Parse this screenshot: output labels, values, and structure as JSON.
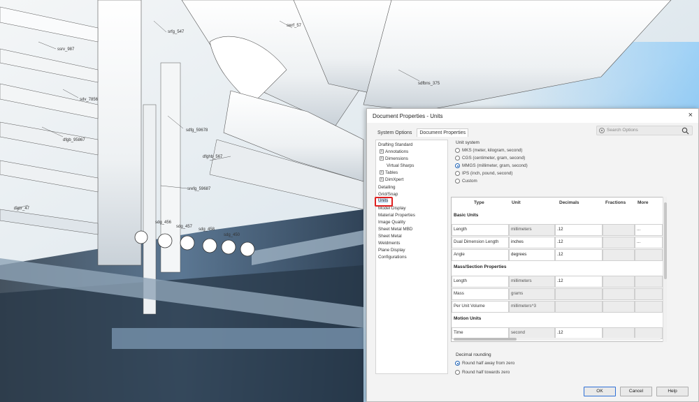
{
  "cad_labels": [
    "ssrv_987",
    "srfg_547",
    "swrf_57",
    "sdv_7856",
    "sdfbns_375",
    "dfgb_95867",
    "sdfg_59678",
    "dfghb_567",
    "srefg_59687",
    "rfgzr_47",
    "sdg_456",
    "sdg_457",
    "sdg_458",
    "sdg_450"
  ],
  "dialog": {
    "title": "Document Properties - Units",
    "close_glyph": "×",
    "tabs": [
      {
        "label": "System Options",
        "active": false
      },
      {
        "label": "Document Properties",
        "active": true
      }
    ],
    "search_placeholder": "Search Options",
    "tree": [
      {
        "label": "Drafting Standard",
        "expander": false,
        "indent": 0
      },
      {
        "label": "Annotations",
        "expander": true,
        "indent": 1
      },
      {
        "label": "Dimensions",
        "expander": true,
        "indent": 1
      },
      {
        "label": "Virtual Sharps",
        "expander": false,
        "indent": 2
      },
      {
        "label": "Tables",
        "expander": true,
        "indent": 1
      },
      {
        "label": "DimXpert",
        "expander": true,
        "indent": 1
      },
      {
        "label": "Detailing",
        "expander": false,
        "indent": 0
      },
      {
        "label": "Grid/Snap",
        "expander": false,
        "indent": 0
      },
      {
        "label": "Units",
        "expander": false,
        "indent": 0,
        "selected": true
      },
      {
        "label": "Model Display",
        "expander": false,
        "indent": 0
      },
      {
        "label": "Material Properties",
        "expander": false,
        "indent": 0
      },
      {
        "label": "Image Quality",
        "expander": false,
        "indent": 0
      },
      {
        "label": "Sheet Metal MBD",
        "expander": false,
        "indent": 0
      },
      {
        "label": "Sheet Metal",
        "expander": false,
        "indent": 0
      },
      {
        "label": "Weldments",
        "expander": false,
        "indent": 0
      },
      {
        "label": "Plane Display",
        "expander": false,
        "indent": 0
      },
      {
        "label": "Configurations",
        "expander": false,
        "indent": 0
      }
    ],
    "unit_system": {
      "label": "Unit system",
      "options": [
        {
          "label": "MKS  (meter, kilogram, second)",
          "selected": false
        },
        {
          "label": "CGS  (centimeter, gram, second)",
          "selected": false
        },
        {
          "label": "MMGS (millimeter, gram, second)",
          "selected": true
        },
        {
          "label": "IPS  (inch, pound, second)",
          "selected": false
        },
        {
          "label": "Custom",
          "selected": false
        }
      ]
    },
    "grid": {
      "headers": [
        "Type",
        "Unit",
        "Decimals",
        "Fractions",
        "More"
      ],
      "sections": [
        {
          "title": "Basic Units",
          "rows": [
            {
              "type": "Length",
              "unit": "millimeters",
              "decimals": ".12",
              "more": "..."
            },
            {
              "type": "Dual Dimension Length",
              "unit": "inches",
              "decimals": ".12",
              "more": "..."
            },
            {
              "type": "Angle",
              "unit": "degrees",
              "decimals": ".12",
              "more": ""
            }
          ]
        },
        {
          "title": "Mass/Section Properties",
          "rows": [
            {
              "type": "Length",
              "unit": "millimeters",
              "decimals": ".12",
              "more": ""
            },
            {
              "type": "Mass",
              "unit": "grams",
              "decimals": "",
              "more": ""
            },
            {
              "type": "Per Unit Volume",
              "unit": "millimeters^3",
              "decimals": "",
              "more": ""
            }
          ]
        },
        {
          "title": "Motion Units",
          "rows": [
            {
              "type": "Time",
              "unit": "second",
              "decimals": ".12",
              "more": ""
            }
          ]
        }
      ]
    },
    "decimal_rounding": {
      "label": "Decimal rounding",
      "options": [
        {
          "label": "Round half away from zero",
          "selected": true
        },
        {
          "label": "Round half towards zero",
          "selected": false
        }
      ]
    },
    "buttons": {
      "ok": "OK",
      "cancel": "Cancel",
      "help": "Help"
    }
  }
}
